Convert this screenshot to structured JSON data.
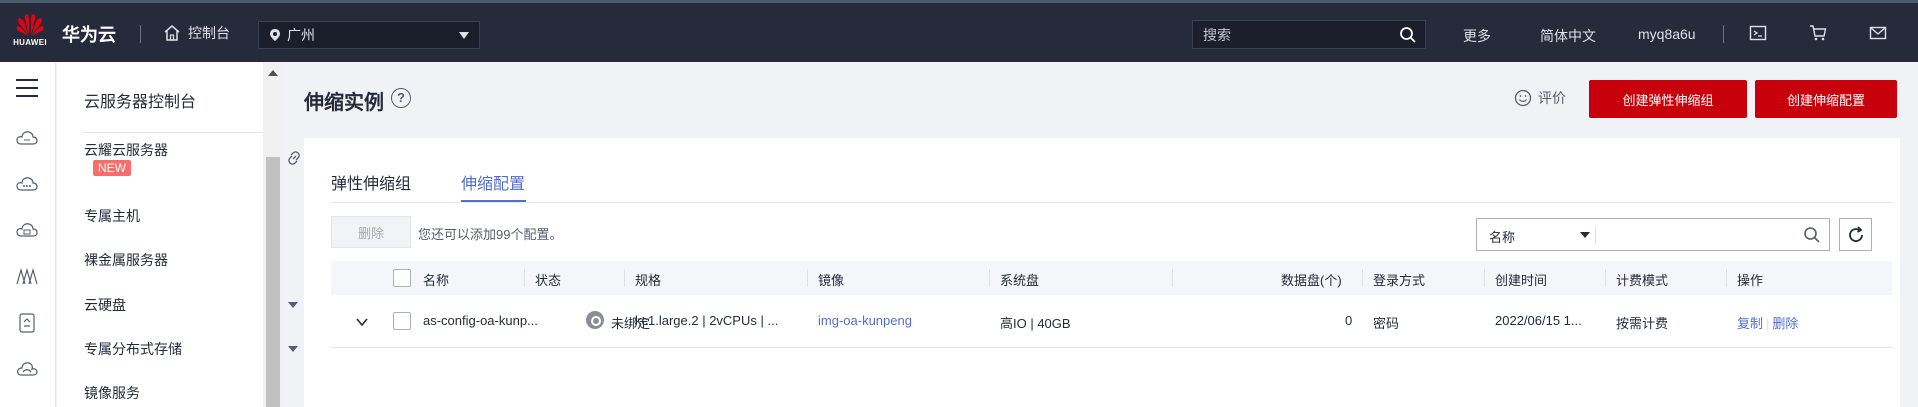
{
  "topbar": {
    "logo_text": "HUAWEI",
    "brand": "华为云",
    "console_label": "控制台",
    "region": "广州",
    "search_placeholder": "搜索",
    "more": "更多",
    "language": "简体中文",
    "username": "myq8a6u",
    "icons": [
      "home-icon",
      "location-icon",
      "search-icon",
      "terminal-icon",
      "cart-icon",
      "mail-icon"
    ]
  },
  "sidebar": {
    "title": "云服务器控制台",
    "items": [
      {
        "label": "云耀云服务器",
        "badge": "NEW",
        "icon": "link-icon"
      },
      {
        "label": "专属主机"
      },
      {
        "label": "裸金属服务器"
      },
      {
        "label": "云硬盘",
        "expandable": true
      },
      {
        "label": "专属分布式存储",
        "expandable": true
      },
      {
        "label": "镜像服务"
      }
    ]
  },
  "header": {
    "title": "伸缩实例",
    "rate_label": "评价",
    "create_group_label": "创建弹性伸缩组",
    "create_config_label": "创建伸缩配置"
  },
  "tabs": [
    {
      "label": "弹性伸缩组",
      "active": false
    },
    {
      "label": "伸缩配置",
      "active": true
    }
  ],
  "toolbar": {
    "delete_label": "删除",
    "hint": "您还可以添加99个配置。",
    "filter_field": "名称"
  },
  "table": {
    "columns": [
      "名称",
      "状态",
      "规格",
      "镜像",
      "系统盘",
      "数据盘(个)",
      "登录方式",
      "创建时间",
      "计费模式",
      "操作"
    ],
    "rows": [
      {
        "name": "as-config-oa-kunp...",
        "status": "未绑定",
        "spec": "kc1.large.2 | 2vCPUs | ...",
        "image": "img-oa-kunpeng",
        "system_disk": "高IO | 40GB",
        "data_disks": "0",
        "login": "密码",
        "created": "2022/06/15 1...",
        "billing": "按需计费",
        "actions": [
          "复制",
          "删除"
        ]
      }
    ]
  },
  "colors": {
    "topbar_bg": "#252b3a",
    "primary_red": "#c7000b",
    "link_blue": "#526ecc",
    "badge_red": "#f66f6a"
  }
}
